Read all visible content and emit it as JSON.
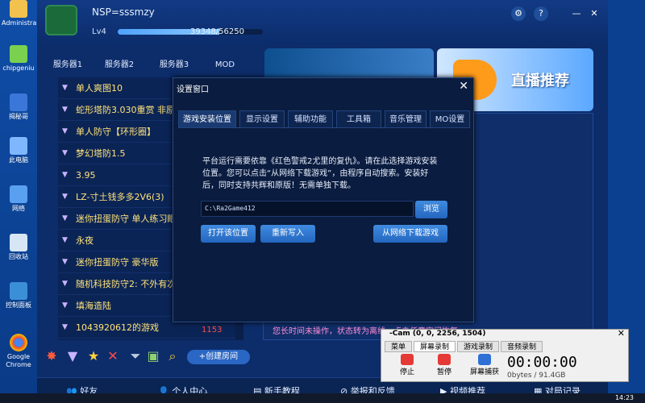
{
  "desktop": {
    "icons": [
      {
        "label": "Administra",
        "icon": "user-folder-icon"
      },
      {
        "label": "chipgeniu",
        "icon": "chip-icon"
      },
      {
        "label": "揭秘哥",
        "icon": "app-icon"
      },
      {
        "label": "此电脑",
        "icon": "computer-icon"
      },
      {
        "label": "网络",
        "icon": "network-icon"
      },
      {
        "label": "回收站",
        "icon": "recycle-bin-icon"
      },
      {
        "label": "控制面板",
        "icon": "control-panel-icon"
      },
      {
        "label": "Google Chrome",
        "icon": "chrome-icon"
      }
    ]
  },
  "header": {
    "nickname": "NSP=sssmzy",
    "level": "Lv4",
    "xp_text": "39348/56250",
    "xp_fraction": 0.7,
    "settings_icon": "gear-icon",
    "help_icon": "help-icon",
    "minimize": "—",
    "close": "✕"
  },
  "server_tabs": [
    "服务器1",
    "服务器2",
    "服务器3",
    "MOD"
  ],
  "servers": [
    "单人爽图10",
    "蛇形塔防3.030重赏 非原",
    "单人防守【环形圈】",
    "梦幻塔防1.5",
    "3.95",
    "LZ-寸土钱多多2V6(3)",
    "迷你扭蛋防守 单人练习眼",
    "永夜",
    "迷你扭蛋防守 豪华版",
    "随机科技防守2: 不外有次",
    "填海造陆",
    "1043920612的游戏"
  ],
  "server_count": "1153",
  "create_room": "+创建房间",
  "banner": {
    "right_text": "直播推荐"
  },
  "right_message": "您长时间未操作，状态转为离线，点击任意空间恢复",
  "bottom_nav": [
    "好友",
    "个人中心",
    "新手教程",
    "举报和反馈",
    "视频推荐",
    "对局记录"
  ],
  "dialog": {
    "title": "设置窗口",
    "close": "✕",
    "tabs": [
      "游戏安装位置",
      "显示设置",
      "辅助功能",
      "工具箱",
      "音乐管理",
      "MO设置"
    ],
    "text": "平台运行需要依靠《红色警戒2尤里的复仇》。请在此选择游戏安装位置。您可以点击“从网络下载游戏”，由程序自动搜索。安装好后，同时支持共辉和原版！无需单独下载。",
    "path": "C:\\Ra2Game412",
    "browse": "浏览",
    "open_location": "打开该位置",
    "rewrite": "重新写入",
    "download": "从网络下载游戏"
  },
  "recorder": {
    "title": "-Cam (0, 0, 2256, 1504)",
    "close": "✕",
    "tabs": [
      "菜单",
      "屏幕录制",
      "游戏录制",
      "音频录制"
    ],
    "stop": "停止",
    "pause": "暂停",
    "capture": "屏幕捕获",
    "timer": "00:00:00",
    "bytes": "0bytes / 91.4GB"
  },
  "taskbar": {
    "time": "14:23"
  }
}
